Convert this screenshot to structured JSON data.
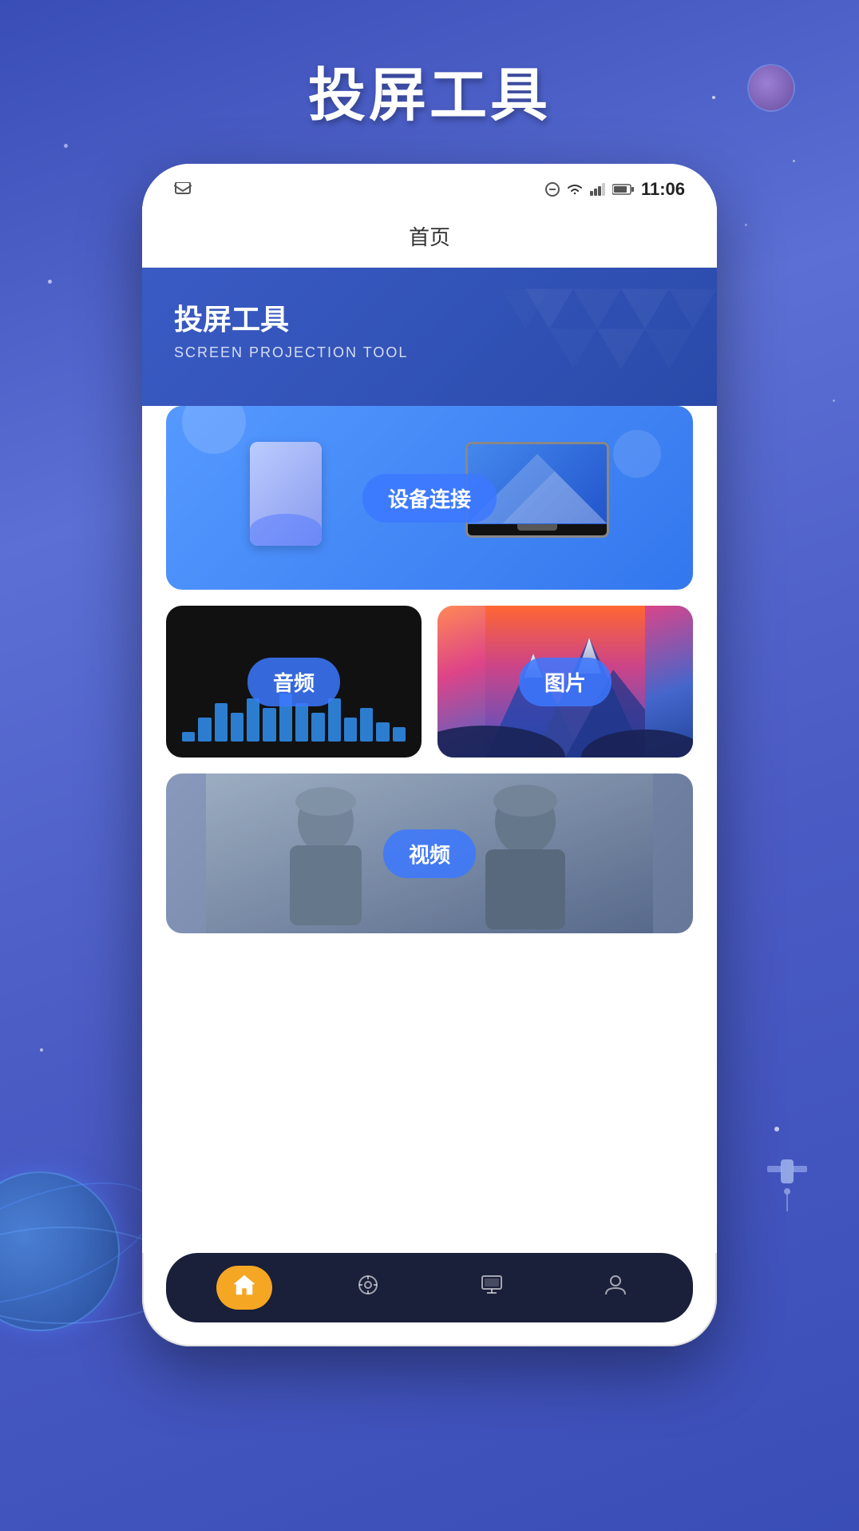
{
  "app": {
    "title": "投屏工具",
    "subtitle_en": "SCREEN PROJECTION TOOL"
  },
  "status_bar": {
    "time": "11:06",
    "icons": [
      "notification",
      "wifi",
      "signal",
      "battery"
    ]
  },
  "header": {
    "page_title": "首页",
    "banner_title": "投屏工具",
    "banner_subtitle": "SCREEN PROJECTION TOOL"
  },
  "features": {
    "device_connect": {
      "label": "设备连接"
    },
    "audio": {
      "label": "音频"
    },
    "photo": {
      "label": "图片"
    },
    "video": {
      "label": "视频"
    }
  },
  "navigation": {
    "items": [
      {
        "id": "home",
        "icon": "🏠",
        "active": true
      },
      {
        "id": "media",
        "icon": "🎬",
        "active": false
      },
      {
        "id": "cast",
        "icon": "📺",
        "active": false
      },
      {
        "id": "profile",
        "icon": "👤",
        "active": false
      }
    ]
  },
  "colors": {
    "primary": "#3a5bc4",
    "accent": "#f5a623",
    "bg_gradient_start": "#3a4db7",
    "bg_gradient_end": "#4a5bc4",
    "nav_bg": "#1a1f3a"
  }
}
